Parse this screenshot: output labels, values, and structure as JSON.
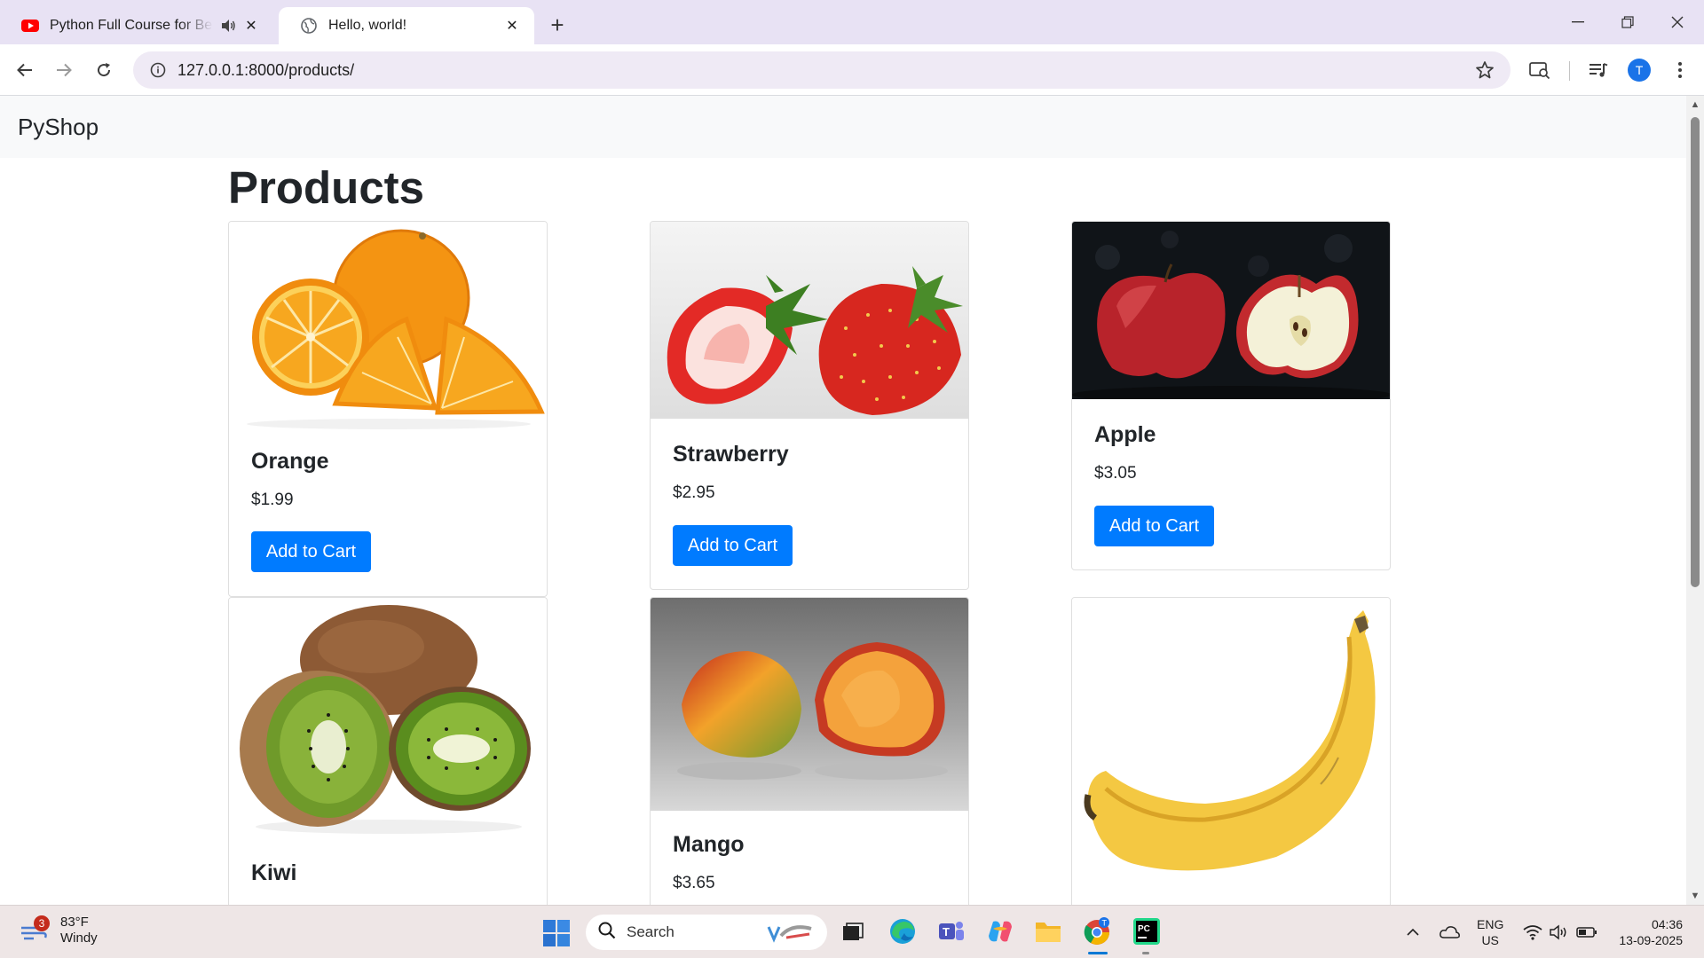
{
  "browser": {
    "tabs": [
      {
        "title": "Python Full Course for Beginners",
        "active": false,
        "icon": "youtube-icon"
      },
      {
        "title": "Hello, world!",
        "active": true,
        "icon": "globe-icon"
      }
    ],
    "url": "127.0.0.1:8000/products/",
    "profile_initial": "T"
  },
  "page": {
    "brand": "PyShop",
    "heading": "Products",
    "products": [
      {
        "name": "Orange",
        "price": "$1.99",
        "button": "Add to Cart"
      },
      {
        "name": "Strawberry",
        "price": "$2.95",
        "button": "Add to Cart"
      },
      {
        "name": "Apple",
        "price": "$3.05",
        "button": "Add to Cart"
      },
      {
        "name": "Kiwi",
        "price": "",
        "button": ""
      },
      {
        "name": "Mango",
        "price": "$3.65",
        "button": ""
      },
      {
        "name": "",
        "price": "",
        "button": ""
      }
    ]
  },
  "taskbar": {
    "weather": {
      "temp": "83°F",
      "condition": "Windy",
      "badge": "3"
    },
    "search_placeholder": "Search",
    "lang": {
      "line1": "ENG",
      "line2": "US"
    },
    "clock": {
      "time": "04:36",
      "date": "13-09-2025"
    },
    "profile_badge": "T"
  },
  "colors": {
    "primary_button": "#007bff",
    "tab_strip": "#e8e2f4",
    "taskbar": "#eee6e6"
  }
}
